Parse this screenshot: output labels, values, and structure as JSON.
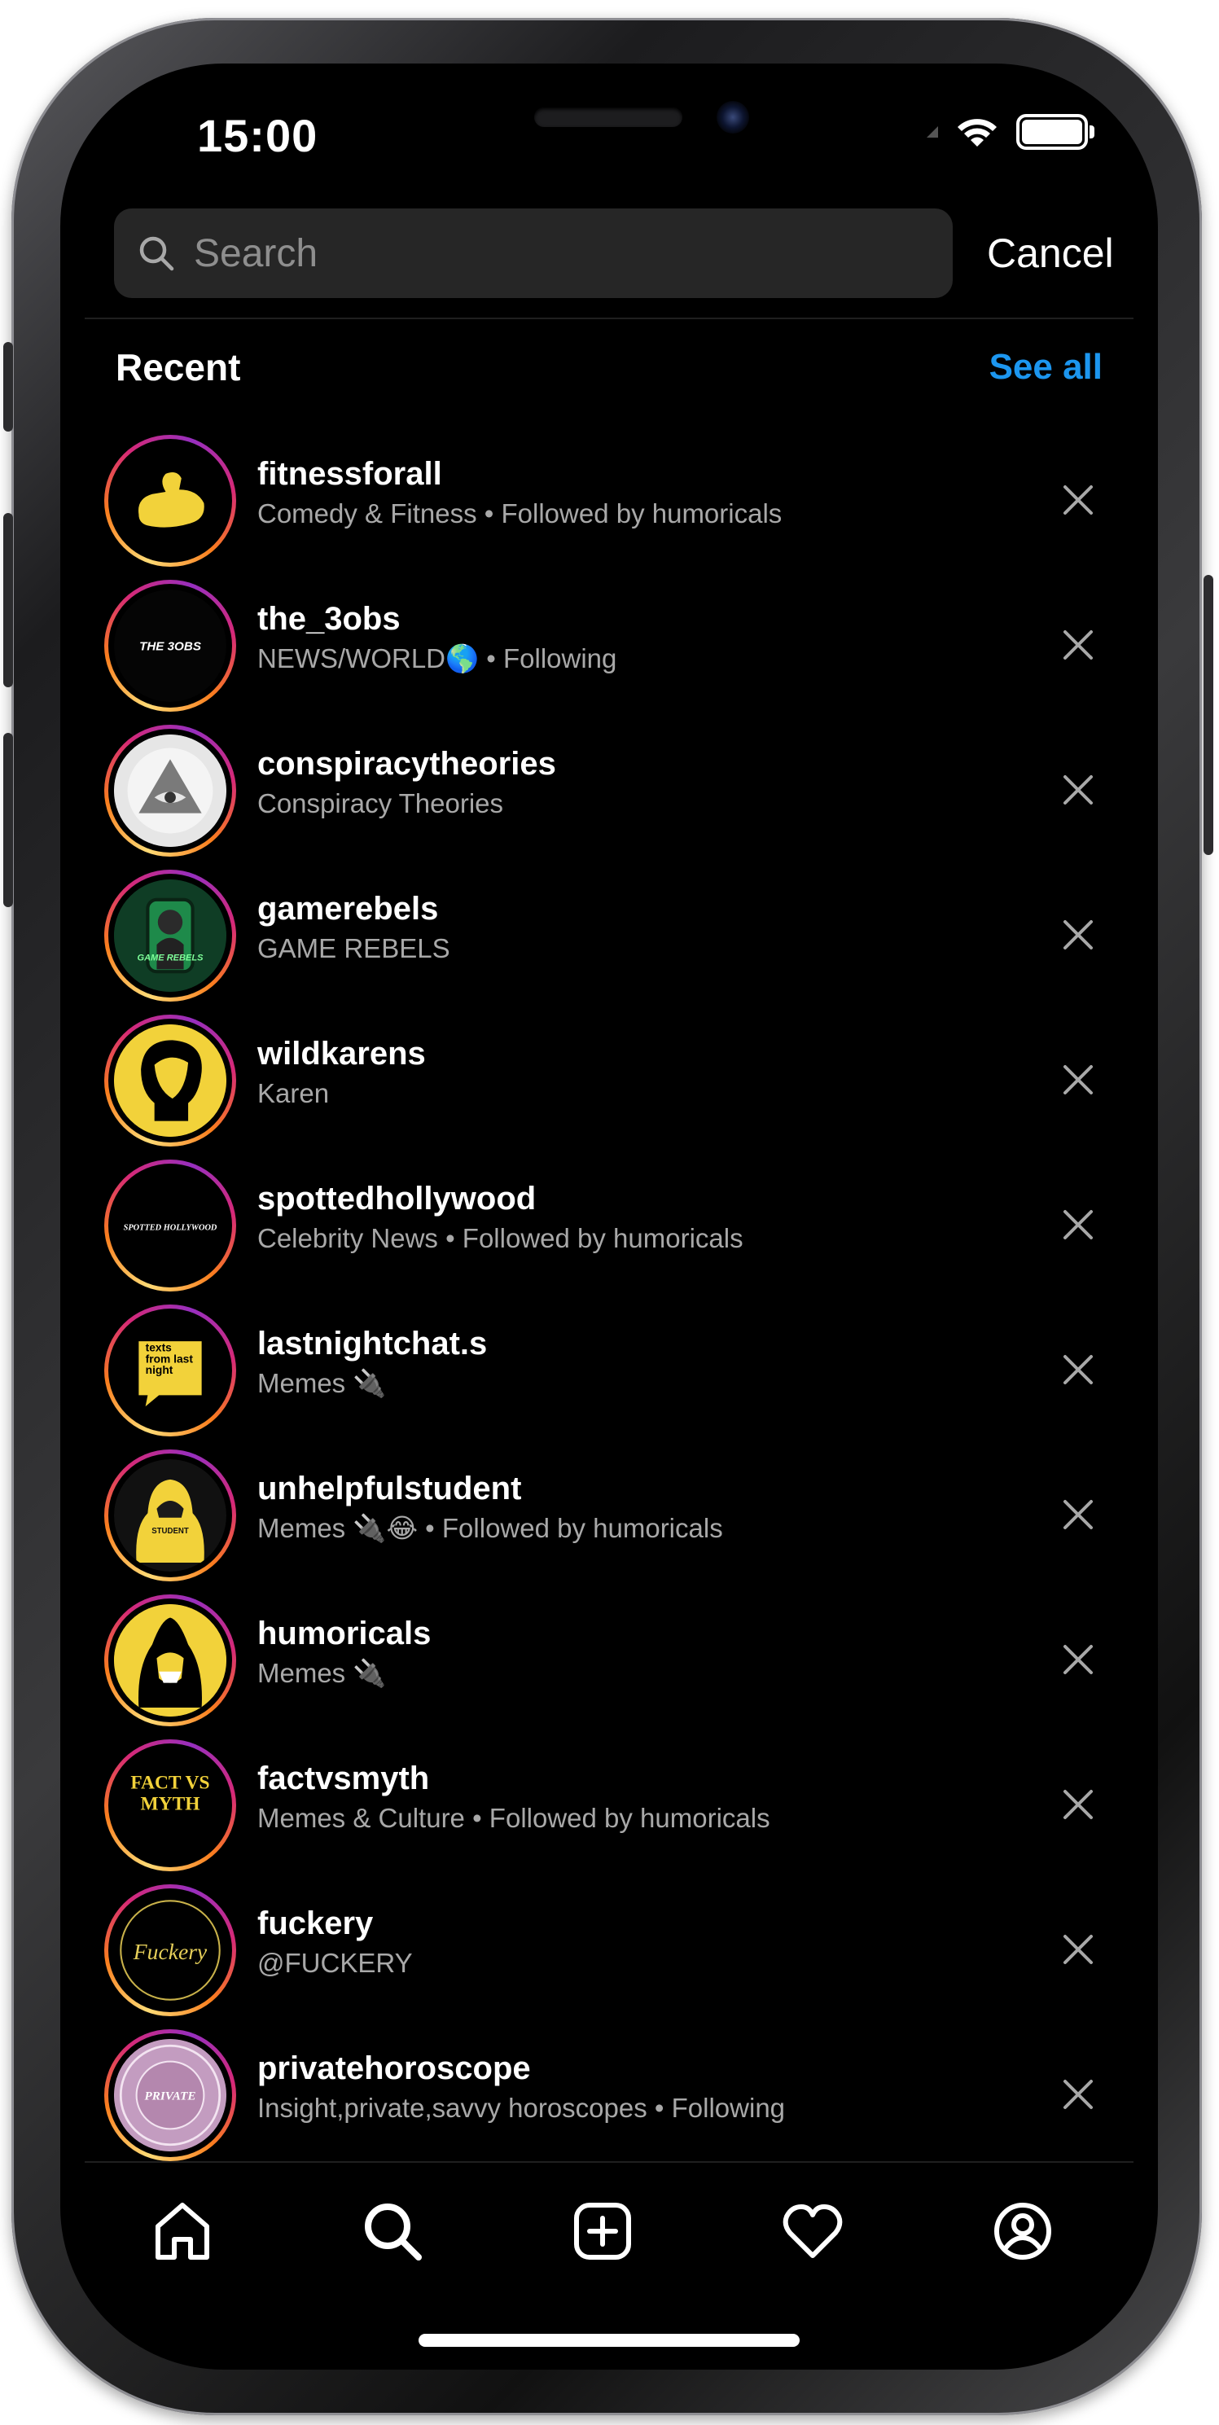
{
  "status_bar": {
    "time": "15:00"
  },
  "search": {
    "placeholder": "Search",
    "cancel_label": "Cancel"
  },
  "recent": {
    "title": "Recent",
    "see_all_label": "See all",
    "items": [
      {
        "username": "fitnessforall",
        "subtitle": "Comedy & Fitness • Followed by humoricals",
        "avatar": "flexed-arm-icon"
      },
      {
        "username": "the_3obs",
        "subtitle": "NEWS/WORLD🌎 • Following",
        "avatar": "the-3obs-logo",
        "avatar_text": "THE 3OBS"
      },
      {
        "username": "conspiracytheories",
        "subtitle": "Conspiracy Theories",
        "avatar": "all-seeing-eye-icon"
      },
      {
        "username": "gamerebels",
        "subtitle": "GAME REBELS",
        "avatar": "game-rebels-logo",
        "avatar_text": "GAME REBELS"
      },
      {
        "username": "wildkarens",
        "subtitle": "Karen",
        "avatar": "karen-silhouette-icon"
      },
      {
        "username": "spottedhollywood",
        "subtitle": "Celebrity News • Followed by humoricals",
        "avatar": "spotted-hollywood-logo",
        "avatar_text": "SPOTTED HOLLYWOOD"
      },
      {
        "username": "lastnightchat.s",
        "subtitle": "Memes 🔌",
        "avatar": "texts-from-last-night-logo",
        "avatar_text": "texts from last night"
      },
      {
        "username": "unhelpfulstudent",
        "subtitle": "Memes 🔌😂 • Followed by humoricals",
        "avatar": "hoodie-student-icon",
        "avatar_text": "STUDENT"
      },
      {
        "username": "humoricals",
        "subtitle": "Memes 🔌",
        "avatar": "hooded-figure-icon"
      },
      {
        "username": "factvsmyth",
        "subtitle": "Memes & Culture • Followed by humoricals",
        "avatar": "fact-vs-myth-logo",
        "avatar_text": "FACT VS MYTH"
      },
      {
        "username": "fuckery",
        "subtitle": "@FUCKERY",
        "avatar": "fuckery-logo",
        "avatar_text": "Fuckery"
      },
      {
        "username": "privatehoroscope",
        "subtitle": "Insight,private,savvy horoscopes • Following",
        "avatar": "zodiac-wheel-icon",
        "avatar_text": "PRIVATE"
      }
    ]
  },
  "tab_bar": {
    "items": [
      "home-icon",
      "search-icon",
      "create-post-icon",
      "activity-heart-icon",
      "profile-icon"
    ]
  },
  "colors": {
    "background": "#000000",
    "accent": "#1c96ef",
    "subtitle": "#a8a8a8",
    "search_bg": "#262626"
  }
}
